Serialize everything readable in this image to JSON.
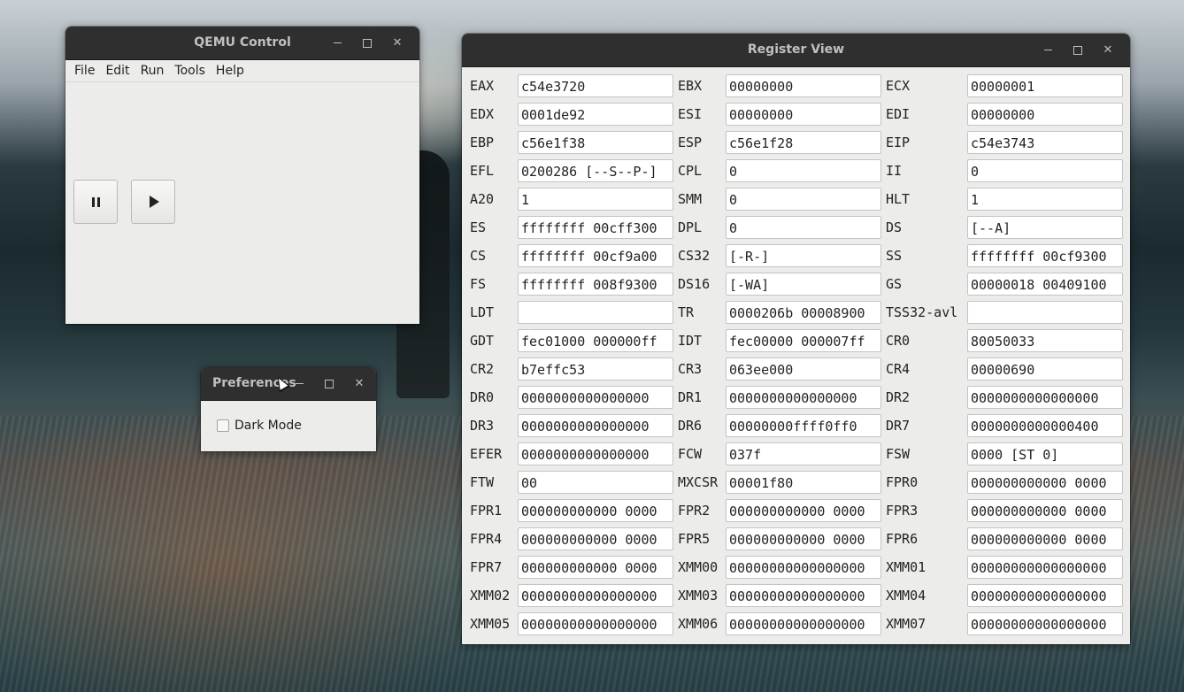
{
  "qemu_control": {
    "title": "QEMU Control",
    "menu": [
      "File",
      "Edit",
      "Run",
      "Tools",
      "Help"
    ]
  },
  "preferences": {
    "title": "Preferences",
    "dark_mode_label": "Dark Mode",
    "dark_mode_checked": false
  },
  "register_view": {
    "title": "Register View",
    "rows": [
      [
        [
          "EAX",
          "c54e3720"
        ],
        [
          "EBX",
          "00000000"
        ],
        [
          "ECX",
          "00000001"
        ]
      ],
      [
        [
          "EDX",
          "0001de92"
        ],
        [
          "ESI",
          "00000000"
        ],
        [
          "EDI",
          "00000000"
        ]
      ],
      [
        [
          "EBP",
          "c56e1f38"
        ],
        [
          "ESP",
          "c56e1f28"
        ],
        [
          "EIP",
          "c54e3743"
        ]
      ],
      [
        [
          "EFL",
          "0200286 [--S--P-]"
        ],
        [
          "CPL",
          "0"
        ],
        [
          "II",
          "0"
        ]
      ],
      [
        [
          "A20",
          "1"
        ],
        [
          "SMM",
          "0"
        ],
        [
          "HLT",
          "1"
        ]
      ],
      [
        [
          "ES",
          "ffffffff 00cff300"
        ],
        [
          "DPL",
          "0"
        ],
        [
          "DS",
          "[--A]"
        ]
      ],
      [
        [
          "CS",
          "ffffffff 00cf9a00"
        ],
        [
          "CS32",
          "[-R-]"
        ],
        [
          "SS",
          "ffffffff 00cf9300"
        ]
      ],
      [
        [
          "FS",
          "ffffffff 008f9300"
        ],
        [
          "DS16",
          "[-WA]"
        ],
        [
          "GS",
          "00000018 00409100"
        ]
      ],
      [
        [
          "LDT",
          ""
        ],
        [
          "TR",
          "0000206b 00008900"
        ],
        [
          "TSS32-avl",
          ""
        ]
      ],
      [
        [
          "GDT",
          "fec01000 000000ff"
        ],
        [
          "IDT",
          "fec00000 000007ff"
        ],
        [
          "CR0",
          "80050033"
        ]
      ],
      [
        [
          "CR2",
          "b7effc53"
        ],
        [
          "CR3",
          "063ee000"
        ],
        [
          "CR4",
          "00000690"
        ]
      ],
      [
        [
          "DR0",
          "0000000000000000"
        ],
        [
          "DR1",
          "0000000000000000"
        ],
        [
          "DR2",
          "0000000000000000"
        ]
      ],
      [
        [
          "DR3",
          "0000000000000000"
        ],
        [
          "DR6",
          "00000000ffff0ff0"
        ],
        [
          "DR7",
          "0000000000000400"
        ]
      ],
      [
        [
          "EFER",
          "0000000000000000"
        ],
        [
          "FCW",
          "037f"
        ],
        [
          "FSW",
          "0000 [ST 0]"
        ]
      ],
      [
        [
          "FTW",
          "00"
        ],
        [
          "MXCSR",
          "00001f80"
        ],
        [
          "FPR0",
          "000000000000 0000"
        ]
      ],
      [
        [
          "FPR1",
          "000000000000 0000"
        ],
        [
          "FPR2",
          "000000000000 0000"
        ],
        [
          "FPR3",
          "000000000000 0000"
        ]
      ],
      [
        [
          "FPR4",
          "000000000000 0000"
        ],
        [
          "FPR5",
          "000000000000 0000"
        ],
        [
          "FPR6",
          "000000000000 0000"
        ]
      ],
      [
        [
          "FPR7",
          "000000000000 0000"
        ],
        [
          "XMM00",
          "00000000000000000"
        ],
        [
          "XMM01",
          "00000000000000000"
        ]
      ],
      [
        [
          "XMM02",
          "00000000000000000"
        ],
        [
          "XMM03",
          "00000000000000000"
        ],
        [
          "XMM04",
          "00000000000000000"
        ]
      ],
      [
        [
          "XMM05",
          "00000000000000000"
        ],
        [
          "XMM06",
          "00000000000000000"
        ],
        [
          "XMM07",
          "00000000000000000"
        ]
      ]
    ]
  }
}
